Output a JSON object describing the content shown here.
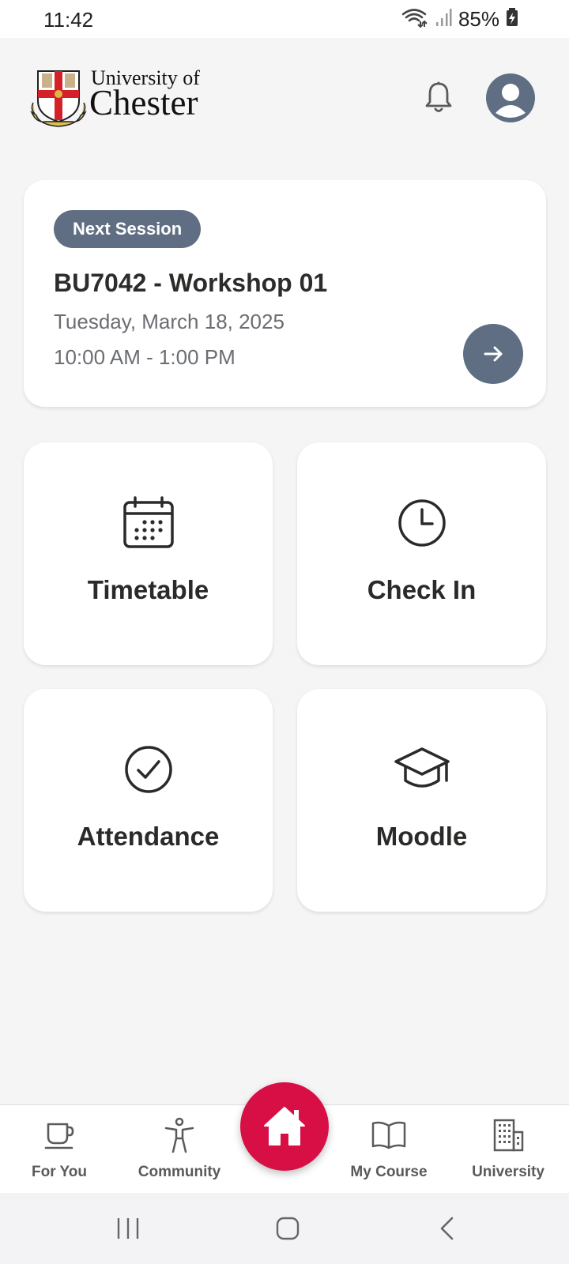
{
  "status_bar": {
    "time": "11:42",
    "battery_percent": "85%",
    "icons": [
      "wifi-icon",
      "signal-icon",
      "battery-charging-icon"
    ]
  },
  "header": {
    "logo_line1": "University of",
    "logo_line2": "Chester",
    "icons": [
      "bell-icon",
      "avatar-icon"
    ]
  },
  "next_session": {
    "badge": "Next Session",
    "title": "BU7042 - Workshop 01",
    "date": "Tuesday, March 18, 2025",
    "time": "10:00 AM - 1:00 PM",
    "action_icon": "arrow-right-icon"
  },
  "tiles": [
    {
      "label": "Timetable",
      "icon": "calendar-icon"
    },
    {
      "label": "Check In",
      "icon": "clock-icon"
    },
    {
      "label": "Attendance",
      "icon": "check-circle-icon"
    },
    {
      "label": "Moodle",
      "icon": "graduation-cap-icon"
    }
  ],
  "bottom_nav": {
    "items": [
      {
        "label": "For You",
        "icon": "cup-icon"
      },
      {
        "label": "Community",
        "icon": "person-icon"
      },
      {
        "label": "My Course",
        "icon": "book-icon"
      },
      {
        "label": "University",
        "icon": "building-icon"
      }
    ],
    "home_icon": "home-icon"
  },
  "colors": {
    "accent": "#d70f45",
    "slate": "#5f6e82",
    "background": "#f5f5f6",
    "text": "#2b2a29"
  }
}
